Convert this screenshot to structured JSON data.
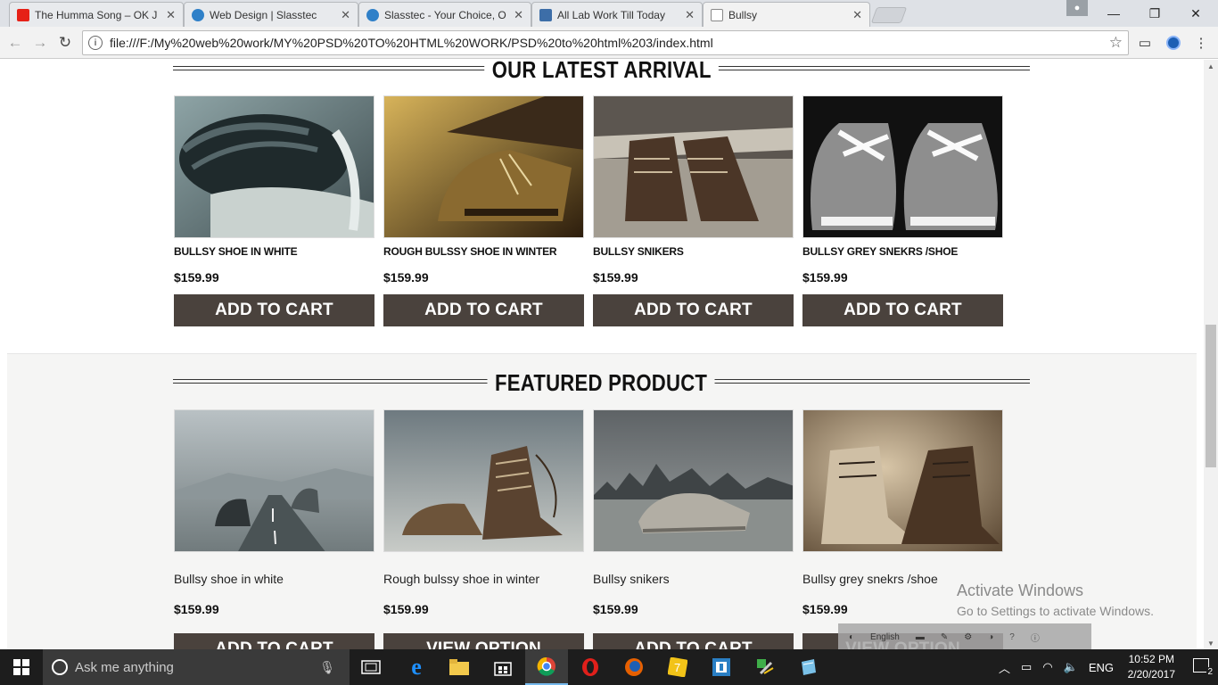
{
  "browser": {
    "tabs": [
      {
        "title": "The Humma Song – OK J",
        "icon": "youtube-icon",
        "color": "#e62117"
      },
      {
        "title": "Web Design | Slasstec",
        "icon": "slasstec-icon",
        "color": "#2f80c8"
      },
      {
        "title": "Slasstec - Your Choice, O",
        "icon": "slasstec-icon",
        "color": "#2f80c8"
      },
      {
        "title": "All Lab Work Till Today",
        "icon": "contact-icon",
        "color": "#3d6ea8"
      },
      {
        "title": "Bullsy",
        "icon": "page-icon",
        "color": "#888888"
      }
    ],
    "tab_close": "✕",
    "url": "file:///F:/My%20web%20work/MY%20PSD%20TO%20HTML%20WORK/PSD%20to%20html%203/index.html"
  },
  "latest": {
    "title": "OUR LATEST ARRIVAL",
    "products": [
      {
        "name": "BULLSY SHOE IN WHITE",
        "price": "$159.99",
        "button": "ADD TO CART"
      },
      {
        "name": "ROUGH BULSSY SHOE IN WINTER",
        "price": "$159.99",
        "button": "ADD TO CART"
      },
      {
        "name": "BULLSY SNIKERS",
        "price": "$159.99",
        "button": "ADD TO CART"
      },
      {
        "name": "BULLSY GREY SNEKRS /SHOE",
        "price": "$159.99",
        "button": "ADD TO CART"
      }
    ]
  },
  "featured": {
    "title": "FEATURED PRODUCT",
    "products": [
      {
        "name": "Bullsy shoe in white",
        "price": "$159.99",
        "button": "ADD TO CART"
      },
      {
        "name": "Rough bulssy shoe in winter",
        "price": "$159.99",
        "button": "VIEW OPTION"
      },
      {
        "name": "Bullsy snikers",
        "price": "$159.99",
        "button": "ADD TO CART"
      },
      {
        "name": "Bullsy grey snekrs /shoe",
        "price": "$159.99",
        "button": "VIEW OPTION"
      }
    ]
  },
  "watermark": {
    "title": "Activate Windows",
    "subtitle": "Go to Settings to activate Windows."
  },
  "langbar": {
    "label": "English"
  },
  "taskbar": {
    "search_placeholder": "Ask me anything",
    "language": "ENG",
    "time": "10:52 PM",
    "date": "2/20/2017",
    "notification_count": "2"
  }
}
